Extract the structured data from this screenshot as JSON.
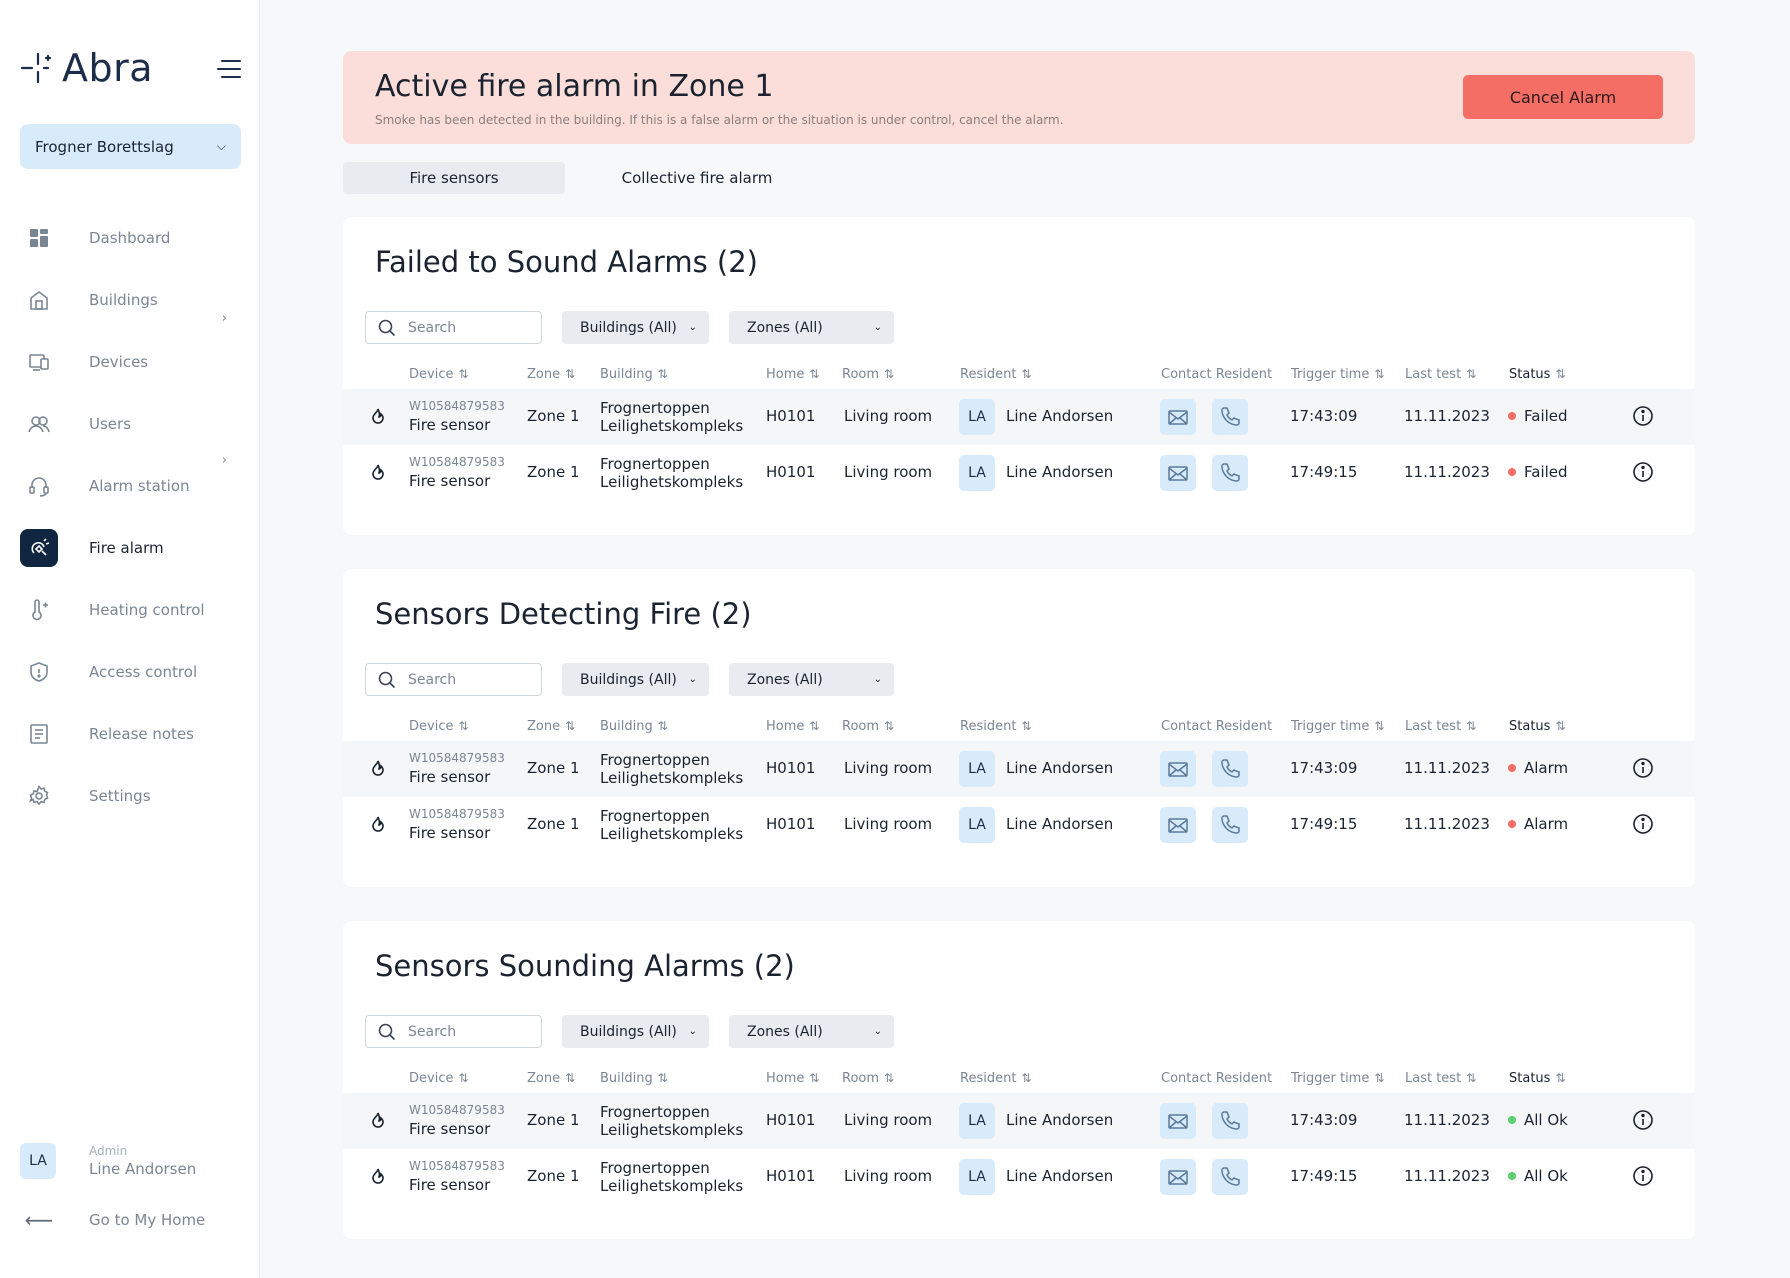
{
  "sidebar": {
    "logo": "Abra",
    "organization": "Frogner Borettslag",
    "nav": [
      {
        "label": "Dashboard",
        "icon": "dashboard-icon",
        "active": false,
        "submenu": false
      },
      {
        "label": "Buildings",
        "icon": "building-icon",
        "active": false,
        "submenu": true
      },
      {
        "label": "Devices",
        "icon": "devices-icon",
        "active": false,
        "submenu": false
      },
      {
        "label": "Users",
        "icon": "users-icon",
        "active": false,
        "submenu": false
      },
      {
        "label": "Alarm station",
        "icon": "headset-icon",
        "active": false,
        "submenu": true
      },
      {
        "label": "Fire alarm",
        "icon": "fire-alarm-icon",
        "active": true,
        "submenu": false
      },
      {
        "label": "Heating control",
        "icon": "thermometer-icon",
        "active": false,
        "submenu": false
      },
      {
        "label": "Access control",
        "icon": "shield-icon",
        "active": false,
        "submenu": false
      },
      {
        "label": "Release notes",
        "icon": "notes-icon",
        "active": false,
        "submenu": false
      },
      {
        "label": "Settings",
        "icon": "gear-icon",
        "active": false,
        "submenu": false
      }
    ],
    "user": {
      "initials": "LA",
      "role": "Admin",
      "name": "Line Andorsen"
    },
    "go_home": "Go to My Home"
  },
  "alert": {
    "title": "Active fire alarm in Zone 1",
    "subtitle": "Smoke has been detected in the building. If this is a false alarm or the situation is under control, cancel the alarm.",
    "cancel_label": "Cancel Alarm"
  },
  "tabs": [
    {
      "label": "Fire sensors",
      "active": true
    },
    {
      "label": "Collective fire alarm",
      "active": false
    }
  ],
  "table": {
    "search_placeholder": "Search",
    "buildings_filter": "Buildings (All)",
    "zones_filter": "Zones (All)",
    "headers": {
      "device": "Device",
      "zone": "Zone",
      "building": "Building",
      "home": "Home",
      "room": "Room",
      "resident": "Resident",
      "contact": "Contact Resident",
      "trigger": "Trigger time",
      "last_test": "Last test",
      "status": "Status"
    }
  },
  "colors": {
    "failed": "#f56e66",
    "alarm": "#f56e66",
    "ok": "#5ccf6e",
    "accent": "#0f2540",
    "badge": "#d8ebfb"
  },
  "sections": [
    {
      "title": "Failed to Sound Alarms (2)",
      "rows": [
        {
          "device_id": "W10584879583",
          "device_type": "Fire sensor",
          "zone": "Zone 1",
          "building_1": "Frognertoppen",
          "building_2": "Leilighetskompleks",
          "home": "H0101",
          "room": "Living room",
          "initials": "LA",
          "resident": "Line Andorsen",
          "trigger": "17:43:09",
          "last_test": "11.11.2023",
          "status": "Failed",
          "status_color": "failed"
        },
        {
          "device_id": "W10584879583",
          "device_type": "Fire sensor",
          "zone": "Zone 1",
          "building_1": "Frognertoppen",
          "building_2": "Leilighetskompleks",
          "home": "H0101",
          "room": "Living room",
          "initials": "LA",
          "resident": "Line Andorsen",
          "trigger": "17:49:15",
          "last_test": "11.11.2023",
          "status": "Failed",
          "status_color": "failed"
        }
      ]
    },
    {
      "title": "Sensors Detecting Fire (2)",
      "rows": [
        {
          "device_id": "W10584879583",
          "device_type": "Fire sensor",
          "zone": "Zone 1",
          "building_1": "Frognertoppen",
          "building_2": "Leilighetskompleks",
          "home": "H0101",
          "room": "Living room",
          "initials": "LA",
          "resident": "Line Andorsen",
          "trigger": "17:43:09",
          "last_test": "11.11.2023",
          "status": "Alarm",
          "status_color": "alarm"
        },
        {
          "device_id": "W10584879583",
          "device_type": "Fire sensor",
          "zone": "Zone 1",
          "building_1": "Frognertoppen",
          "building_2": "Leilighetskompleks",
          "home": "H0101",
          "room": "Living room",
          "initials": "LA",
          "resident": "Line Andorsen",
          "trigger": "17:49:15",
          "last_test": "11.11.2023",
          "status": "Alarm",
          "status_color": "alarm"
        }
      ]
    },
    {
      "title": "Sensors Sounding Alarms (2)",
      "rows": [
        {
          "device_id": "W10584879583",
          "device_type": "Fire sensor",
          "zone": "Zone 1",
          "building_1": "Frognertoppen",
          "building_2": "Leilighetskompleks",
          "home": "H0101",
          "room": "Living room",
          "initials": "LA",
          "resident": "Line Andorsen",
          "trigger": "17:43:09",
          "last_test": "11.11.2023",
          "status": "All Ok",
          "status_color": "ok"
        },
        {
          "device_id": "W10584879583",
          "device_type": "Fire sensor",
          "zone": "Zone 1",
          "building_1": "Frognertoppen",
          "building_2": "Leilighetskompleks",
          "home": "H0101",
          "room": "Living room",
          "initials": "LA",
          "resident": "Line Andorsen",
          "trigger": "17:49:15",
          "last_test": "11.11.2023",
          "status": "All Ok",
          "status_color": "ok"
        }
      ]
    }
  ]
}
